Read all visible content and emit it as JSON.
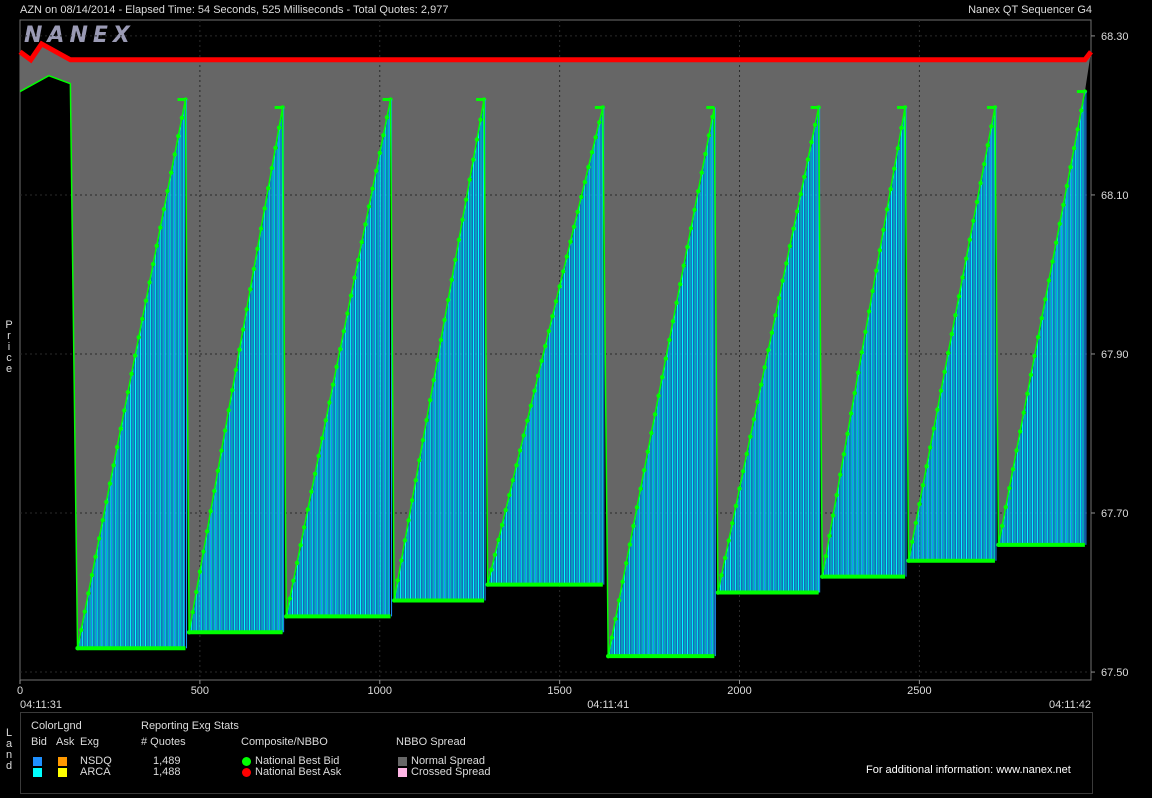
{
  "header": {
    "left": "AZN on 08/14/2014  -  Elapsed Time: 54 Seconds, 525 Milliseconds  -  Total Quotes: 2,977",
    "right": "Nanex QT Sequencer G4"
  },
  "logo": "NANEX",
  "ylabel_vertical": "Price",
  "legend_side": "Land",
  "colors": {
    "bid_green": "#00ff00",
    "ask_red": "#ff0000",
    "spread_gray": "#666666",
    "nsdq_blue": "#1e90ff",
    "arca_cyan": "#00ffff",
    "nsdq_orange": "#ff9900",
    "arca_yellow": "#ffff00",
    "crossed_pink": "#ffb6e6"
  },
  "chart_data": {
    "type": "line",
    "title": "",
    "xlabel": "",
    "ylabel": "Price",
    "xlim": [
      0,
      2977
    ],
    "ylim": [
      67.49,
      68.32
    ],
    "x_ticks": [
      "0",
      "500",
      "1000",
      "1500",
      "2000",
      "2500"
    ],
    "x_tick_values": [
      0,
      500,
      1000,
      1500,
      2000,
      2500
    ],
    "time_labels": [
      {
        "x": 0,
        "label": "04:11:31"
      },
      {
        "x": 1635,
        "label": "04:11:41"
      },
      {
        "x": 2977,
        "label": "04:11:42"
      }
    ],
    "y_ticks": [
      "67.50",
      "67.70",
      "67.90",
      "68.10",
      "68.30"
    ],
    "y_tick_values": [
      67.5,
      67.7,
      67.9,
      68.1,
      68.3
    ],
    "series": [
      {
        "name": "National Best Ask",
        "points": [
          [
            0,
            68.28
          ],
          [
            30,
            68.27
          ],
          [
            60,
            68.29
          ],
          [
            140,
            68.27
          ],
          [
            2960,
            68.27
          ],
          [
            2977,
            68.28
          ]
        ]
      },
      {
        "name": "National Best Bid",
        "points": [
          [
            0,
            68.23
          ],
          [
            80,
            68.25
          ],
          [
            140,
            68.24
          ],
          [
            160,
            67.53
          ],
          [
            460,
            68.22
          ],
          [
            470,
            67.55
          ],
          [
            730,
            68.21
          ],
          [
            740,
            67.57
          ],
          [
            1030,
            68.22
          ],
          [
            1040,
            67.59
          ],
          [
            1290,
            68.22
          ],
          [
            1300,
            67.61
          ],
          [
            1620,
            68.21
          ],
          [
            1635,
            67.52
          ],
          [
            1930,
            68.21
          ],
          [
            1940,
            67.6
          ],
          [
            2220,
            68.21
          ],
          [
            2230,
            67.62
          ],
          [
            2460,
            68.21
          ],
          [
            2470,
            67.64
          ],
          [
            2710,
            68.21
          ],
          [
            2720,
            67.66
          ],
          [
            2960,
            68.23
          ]
        ]
      }
    ],
    "sawtooth_cycles": [
      {
        "start": 160,
        "end": 460,
        "floor": 67.53,
        "peak": 68.22
      },
      {
        "start": 470,
        "end": 730,
        "floor": 67.55,
        "peak": 68.21
      },
      {
        "start": 740,
        "end": 1030,
        "floor": 67.57,
        "peak": 68.22
      },
      {
        "start": 1040,
        "end": 1290,
        "floor": 67.59,
        "peak": 68.22
      },
      {
        "start": 1300,
        "end": 1620,
        "floor": 67.61,
        "peak": 68.21
      },
      {
        "start": 1635,
        "end": 1930,
        "floor": 67.52,
        "peak": 68.21
      },
      {
        "start": 1940,
        "end": 2220,
        "floor": 67.6,
        "peak": 68.21
      },
      {
        "start": 2230,
        "end": 2460,
        "floor": 67.62,
        "peak": 68.21
      },
      {
        "start": 2470,
        "end": 2710,
        "floor": 67.64,
        "peak": 68.21
      },
      {
        "start": 2720,
        "end": 2960,
        "floor": 67.66,
        "peak": 68.23
      }
    ],
    "grid": true,
    "legend_position": "bottom"
  },
  "legend": {
    "title": "ColorLgnd",
    "col_bid": "Bid",
    "col_ask": "Ask",
    "col_exg": "Exg",
    "stats_title": "Reporting Exg Stats",
    "quotes_header": "# Quotes",
    "exchanges": [
      {
        "name": "NSDQ",
        "quotes": "1,489"
      },
      {
        "name": "ARCA",
        "quotes": "1,488"
      }
    ],
    "nbbo_title": "Composite/NBBO",
    "nbbo_bid": "National Best Bid",
    "nbbo_ask": "National Best Ask",
    "spread_title": "NBBO Spread",
    "spread_normal": "Normal Spread",
    "spread_crossed": "Crossed Spread",
    "footer": "For additional information: www.nanex.net"
  }
}
